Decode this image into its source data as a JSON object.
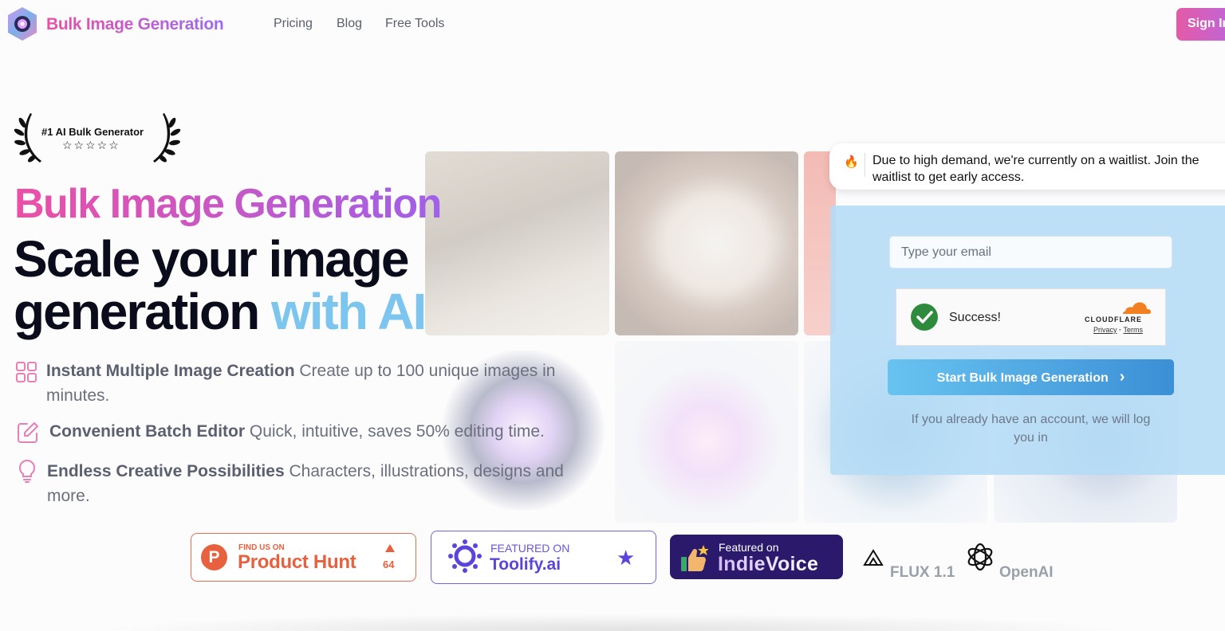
{
  "nav": {
    "brand": "Bulk Image Generation",
    "links": [
      "Pricing",
      "Blog",
      "Free Tools"
    ],
    "sign_in": "Sign In"
  },
  "badge": {
    "text": "#1 AI Bulk Generator",
    "stars": "☆☆☆☆☆"
  },
  "hero": {
    "title": "Bulk Image Generation",
    "line1": "Scale your image",
    "line2_start": "generation ",
    "line2_accent": "with AI"
  },
  "features": [
    {
      "title": "Instant Multiple Image Creation",
      "text": " Create up to 100 unique images in minutes.",
      "icon": "grid-icon"
    },
    {
      "title": "Convenient Batch Editor",
      "text": " Quick, intuitive, saves 50% editing time.",
      "icon": "edit-icon"
    },
    {
      "title": "Endless Creative Possibilities",
      "text": " Characters, illustrations, designs and more.",
      "icon": "lightbulb-icon"
    }
  ],
  "notice": {
    "icon": "🔥",
    "text": "Due to high demand, we're currently on a waitlist. Join the waitlist to get early access."
  },
  "form": {
    "email_placeholder": "Type your email",
    "captcha_status": "Success!",
    "captcha_brand": "CLOUDFLARE",
    "captcha_privacy": "Privacy",
    "captcha_sep": " · ",
    "captcha_terms": "Terms",
    "submit": "Start Bulk Image Generation",
    "login_note": "If you already have an account, we will log you in"
  },
  "logos": {
    "producthunt": {
      "small": "FIND US ON",
      "big": "Product Hunt",
      "count": "64",
      "letter": "P"
    },
    "toolify": {
      "small": "FEATURED ON",
      "big": "Toolify.ai"
    },
    "indievoice": {
      "small": "Featured on",
      "big": "IndieVoice"
    },
    "flux": "FLUX 1.1",
    "openai": "OpenAI"
  },
  "colors": {
    "brand_gradient_start": "#ec4fa6",
    "brand_gradient_end": "#9b6bf0",
    "accent_blue": "#7cc5ef",
    "producthunt": "#e8613f",
    "toolify": "#5b44dc",
    "indievoice_bg": "#2b1a6b"
  }
}
